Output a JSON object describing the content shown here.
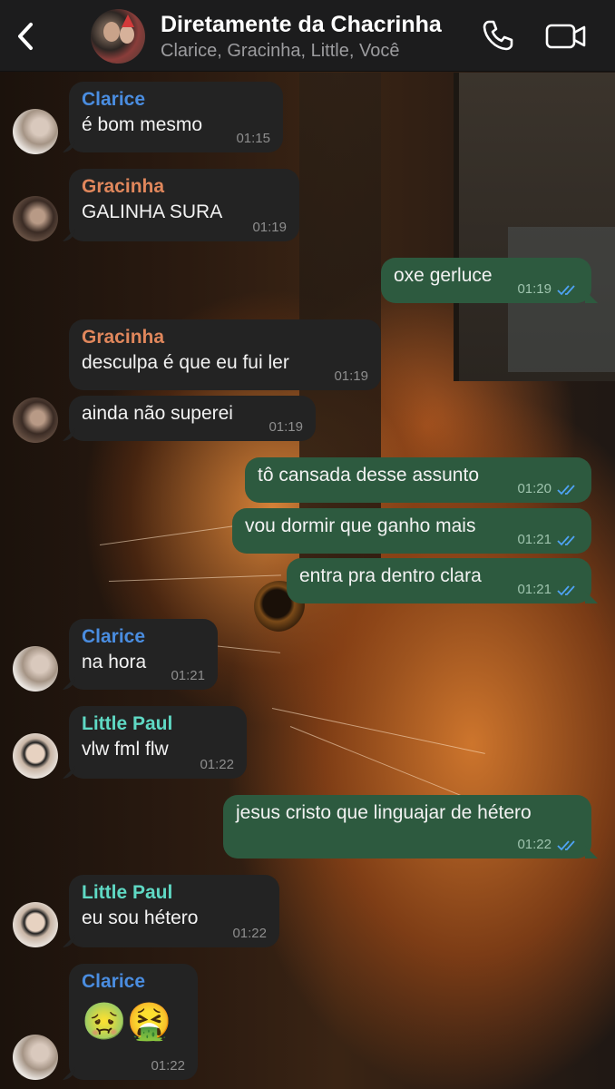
{
  "header": {
    "title": "Diretamente da Chacrinha",
    "subtitle": "Clarice, Gracinha, Little, Você"
  },
  "colors": {
    "clarice": "#4a8de0",
    "gracinha": "#e0875c",
    "little_paul": "#5fd9c4",
    "incoming_bubble": "#232323",
    "outgoing_bubble": "#2d5a3f",
    "read_ticks": "#4fa3f5"
  },
  "messages": [
    {
      "direction": "in",
      "sender": "Clarice",
      "text": "é bom mesmo",
      "time": "01:15"
    },
    {
      "direction": "in",
      "sender": "Gracinha",
      "text": "GALINHA SURA",
      "time": "01:19"
    },
    {
      "direction": "out",
      "text": "oxe gerluce",
      "time": "01:19",
      "status": "read"
    },
    {
      "direction": "in",
      "sender": "Gracinha",
      "text": "desculpa é que eu fui ler",
      "time": "01:19"
    },
    {
      "direction": "in",
      "text": "ainda não superei",
      "time": "01:19"
    },
    {
      "direction": "out",
      "text": "tô cansada desse assunto",
      "time": "01:20",
      "status": "read"
    },
    {
      "direction": "out",
      "text": "vou dormir que ganho mais",
      "time": "01:21",
      "status": "read"
    },
    {
      "direction": "out",
      "text": "entra pra dentro clara",
      "time": "01:21",
      "status": "read"
    },
    {
      "direction": "in",
      "sender": "Clarice",
      "text": "na hora",
      "time": "01:21"
    },
    {
      "direction": "in",
      "sender": "Little Paul",
      "text": "vlw fml flw",
      "time": "01:22"
    },
    {
      "direction": "out",
      "text": "jesus cristo que linguajar de hétero",
      "time": "01:22",
      "status": "read"
    },
    {
      "direction": "in",
      "sender": "Little Paul",
      "text": "eu sou hétero",
      "time": "01:22"
    },
    {
      "direction": "in",
      "sender": "Clarice",
      "text": "🤢🤮",
      "time": "01:22"
    }
  ],
  "icons": [
    "back-chevron-icon",
    "phone-icon",
    "video-camera-icon",
    "double-check-icon"
  ]
}
